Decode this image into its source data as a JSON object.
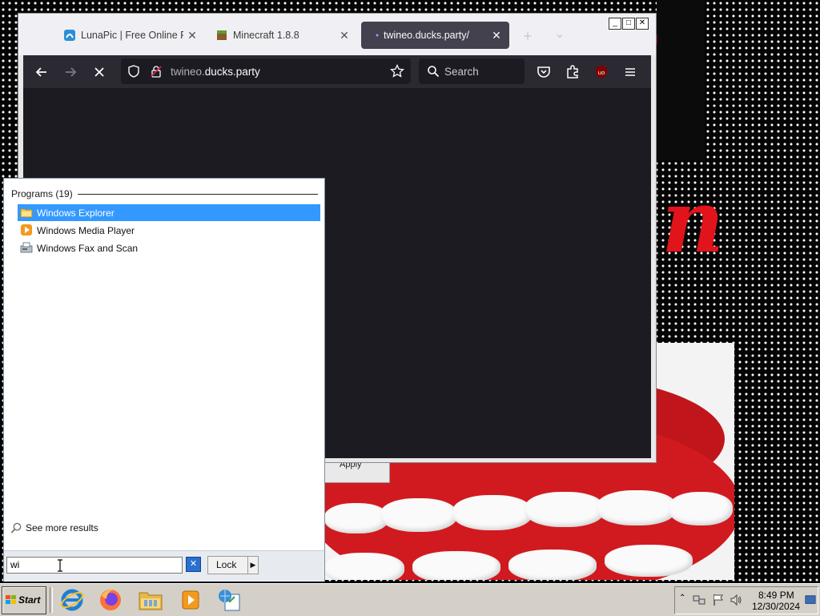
{
  "browser": {
    "tabs": [
      {
        "label": "LunaPic | Free Online Ph",
        "favicon": "lunapic-favicon",
        "active": false
      },
      {
        "label": "Minecraft 1.8.8",
        "favicon": "minecraft-favicon",
        "active": false
      },
      {
        "label": "twineo.ducks.party/",
        "favicon": "loading-dot-icon",
        "active": true
      }
    ],
    "tab_close_glyph": "✕",
    "new_tab_glyph": "+",
    "tab_list_glyph": "⌄",
    "window_buttons": {
      "minimize": "_",
      "maximize": "□",
      "close": "✕"
    },
    "url": {
      "subdomain": "twineo.",
      "domain": "ducks.party"
    },
    "search_placeholder": "Search",
    "ublock_badge": "uo",
    "theme_color": "#2b2a33"
  },
  "desktop": {
    "apply_button": "Apply",
    "glyph_n": "n"
  },
  "start_menu": {
    "section_title": "Programs (19)",
    "programs": [
      {
        "label": "Windows Explorer",
        "icon": "folder-icon",
        "selected": true
      },
      {
        "label": "Windows Media Player",
        "icon": "media-player-icon",
        "selected": false
      },
      {
        "label": "Windows Fax and Scan",
        "icon": "fax-icon",
        "selected": false
      }
    ],
    "see_more": "See more results",
    "search_value": "wi",
    "clear_glyph": "✕",
    "lock_button": "Lock",
    "lock_arrow": "▶",
    "selection_color": "#3399ff"
  },
  "taskbar": {
    "start_label": "Start",
    "pinned": [
      "internet-explorer-icon",
      "firefox-icon",
      "explorer-folder-icon",
      "media-player-icon",
      "control-panel-icon"
    ],
    "tray_icons": [
      "show-hidden-icons-chevron",
      "network-icon",
      "action-center-flag-icon",
      "volume-icon",
      "show-desktop-icon"
    ],
    "clock_time": "8:49 PM",
    "clock_date": "12/30/2024"
  }
}
